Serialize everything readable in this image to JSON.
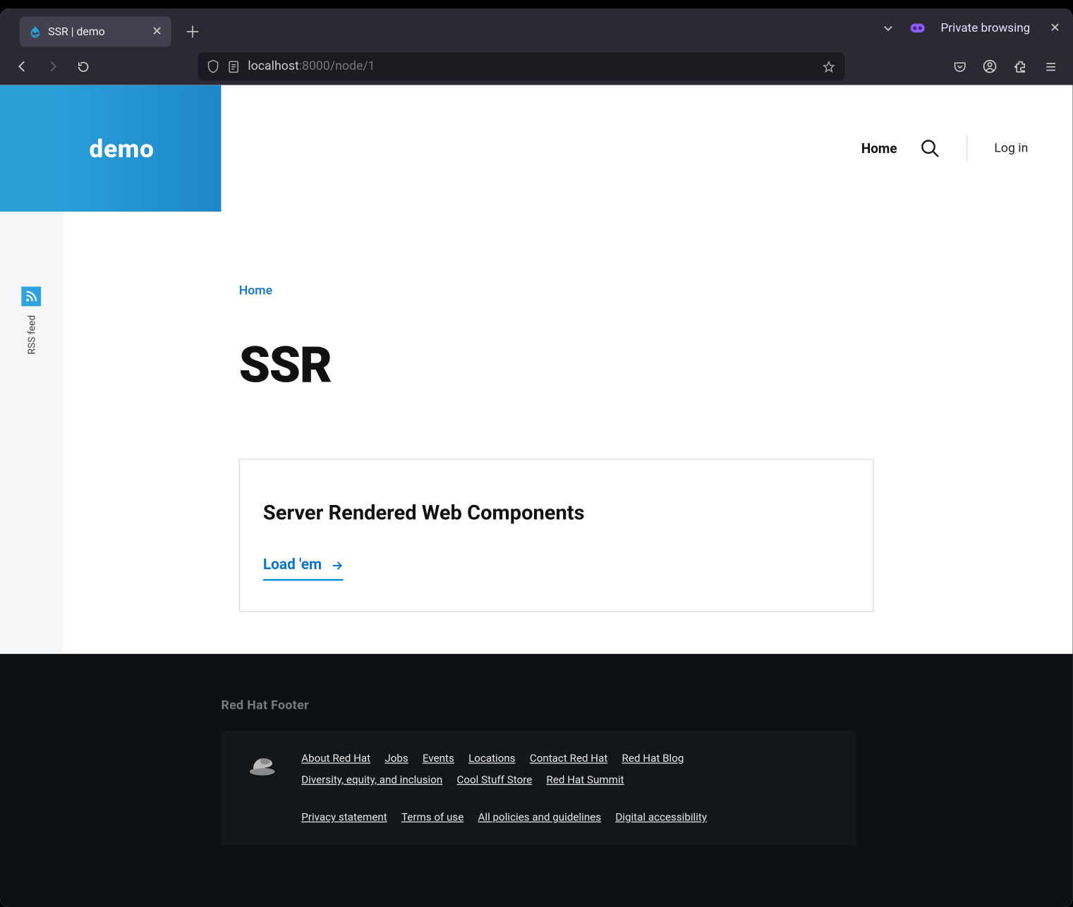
{
  "browser": {
    "tab_title": "SSR | demo",
    "private_label": "Private browsing",
    "url_host": "localhost",
    "url_port_path": ":8000/node/1"
  },
  "header": {
    "logo_text": "demo",
    "home": "Home",
    "login": "Log in"
  },
  "sidebar": {
    "rss_label": "RSS feed"
  },
  "main": {
    "breadcrumb": "Home",
    "title": "SSR",
    "card_title": "Server Rendered Web Components",
    "card_link": "Load 'em"
  },
  "footer": {
    "heading": "Red Hat Footer",
    "links_row1": [
      "About Red Hat",
      "Jobs",
      "Events",
      "Locations",
      "Contact Red Hat",
      "Red Hat Blog"
    ],
    "links_row1b": [
      "Diversity, equity, and inclusion",
      "Cool Stuff Store",
      "Red Hat Summit"
    ],
    "links_row2": [
      "Privacy statement",
      "Terms of use",
      "All policies and guidelines",
      "Digital accessibility"
    ]
  }
}
